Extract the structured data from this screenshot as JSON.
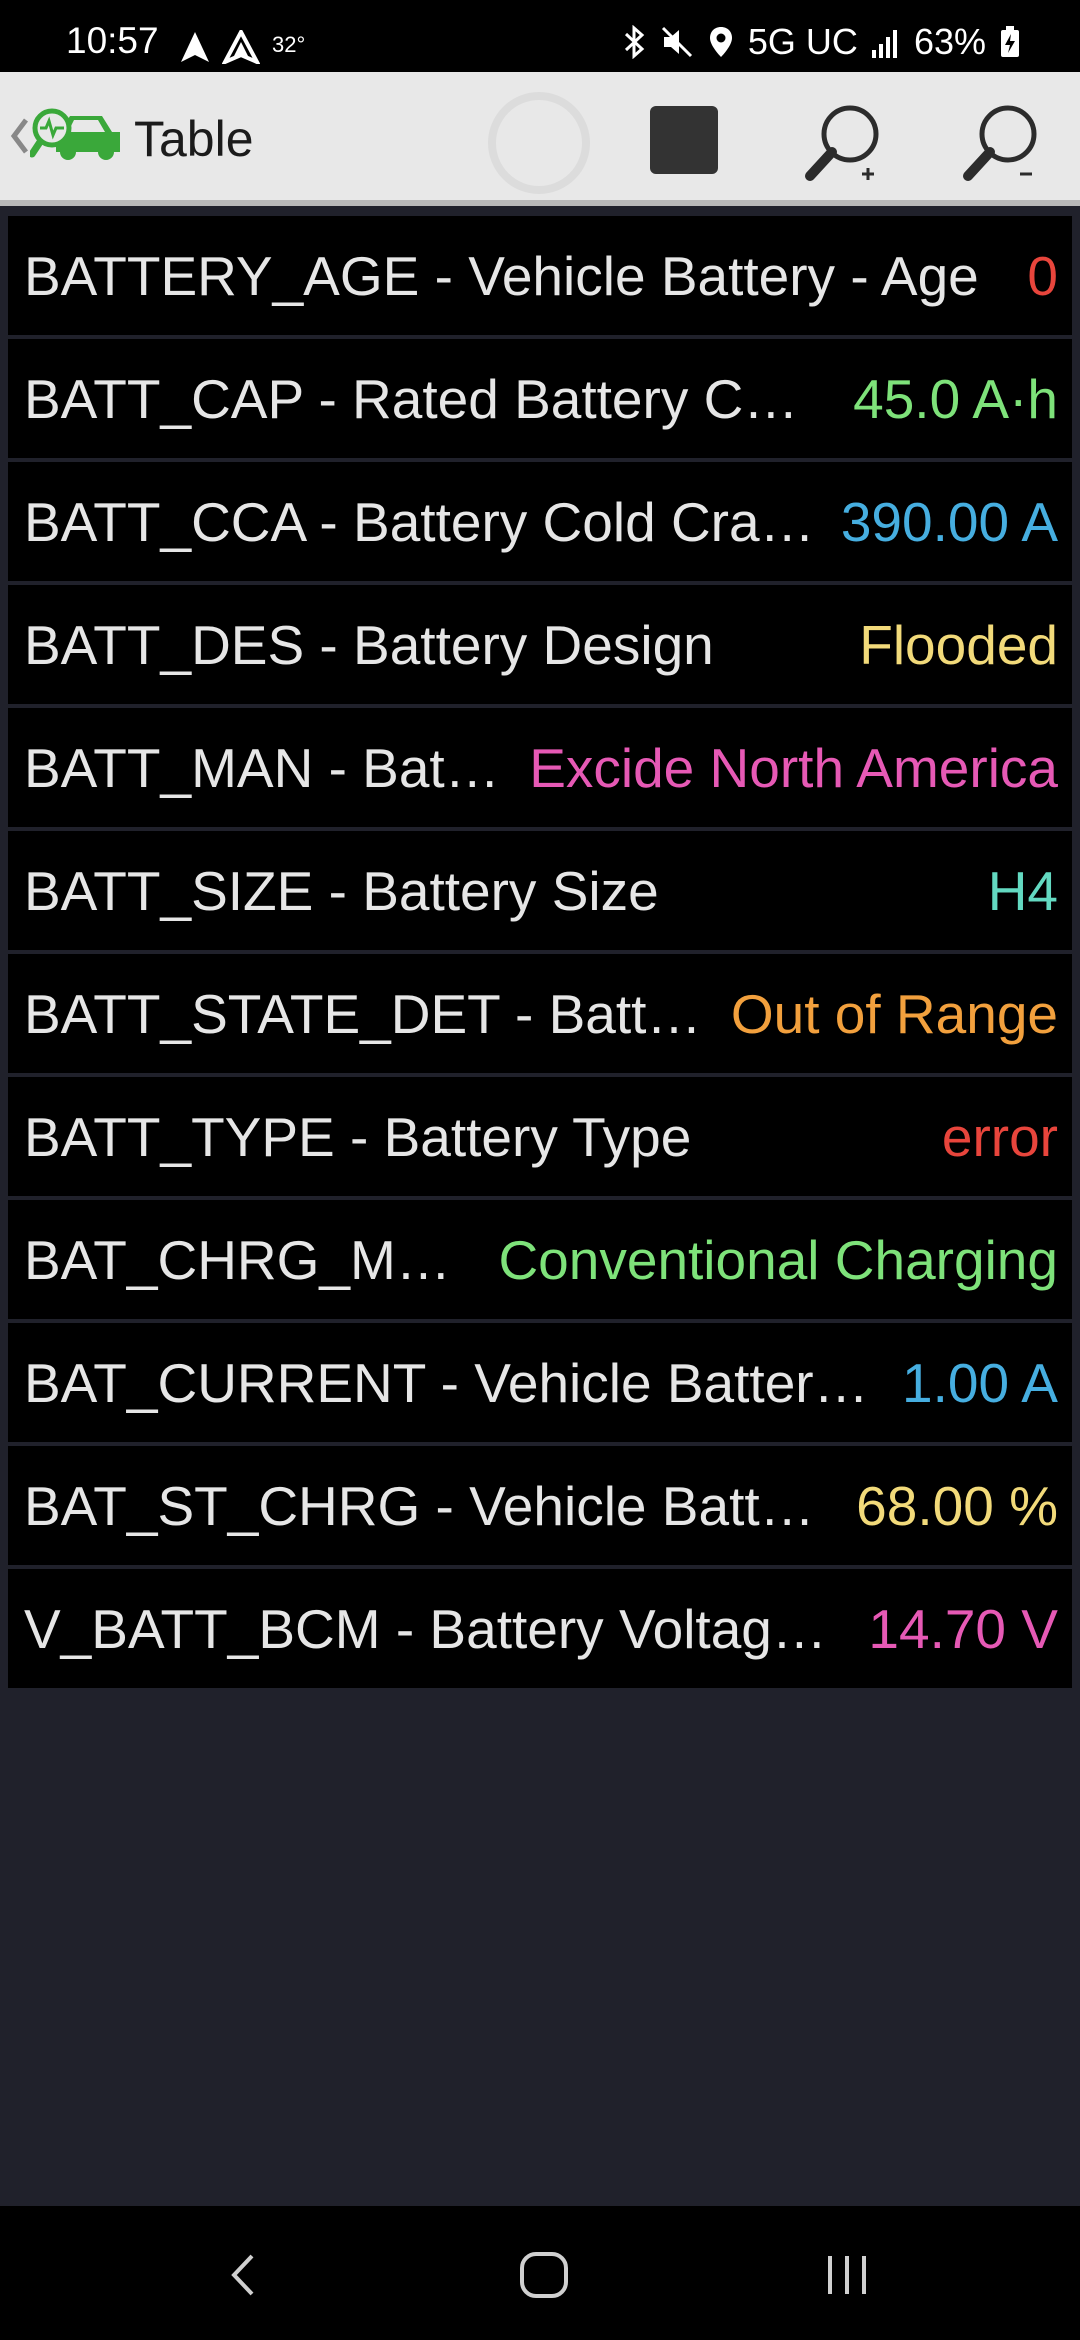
{
  "status_bar": {
    "time": "10:57",
    "temperature": "32°",
    "network": "5G UC",
    "battery": "63%",
    "icons": [
      "navigation-icon",
      "navigation-outline-icon",
      "bluetooth-icon",
      "mute-icon",
      "location-icon",
      "signal-icon",
      "battery-charging-icon"
    ]
  },
  "app_bar": {
    "title": "Table",
    "icons": [
      "back-chevron-icon",
      "car-diagnostic-logo-icon",
      "loading-spinner-icon",
      "stop-icon",
      "zoom-in-icon",
      "zoom-out-icon"
    ]
  },
  "rows": [
    {
      "label": "BATTERY_AGE - Vehicle Battery - Age",
      "value": "0",
      "color": "#e8453c"
    },
    {
      "label": "BATT_CAP - Rated Battery Capacity",
      "value": "45.0 A·h",
      "color": "#7ee27a"
    },
    {
      "label": "BATT_CCA - Battery Cold Cranking Amps",
      "value": "390.00 A",
      "color": "#46aee0"
    },
    {
      "label": "BATT_DES - Battery Design",
      "value": "Flooded",
      "color": "#f2da7a"
    },
    {
      "label": "BATT_MAN - Battery Manufacturer",
      "value": "Excide North America",
      "color": "#e659b5"
    },
    {
      "label": "BATT_SIZE - Battery Size",
      "value": "H4",
      "color": "#63d9c1"
    },
    {
      "label": "BATT_STATE_DET - Battery State Detection",
      "value": "Out of Range",
      "color": "#f2a03d"
    },
    {
      "label": "BATT_TYPE - Battery Type",
      "value": "error",
      "color": "#e8453c"
    },
    {
      "label": "BAT_CHRG_MODE - Battery Charging Mode",
      "value": "Conventional Charging",
      "color": "#7ee27a"
    },
    {
      "label": "BAT_CURRENT - Vehicle Battery Current",
      "value": "1.00 A",
      "color": "#46aee0"
    },
    {
      "label": "BAT_ST_CHRG - Vehicle Battery State of Charge",
      "value": "68.00 %",
      "color": "#f2da7a"
    },
    {
      "label": "V_BATT_BCM - Battery Voltage BCM",
      "value": "14.70 V",
      "color": "#e659b5"
    }
  ],
  "nav_bar": {
    "icons": [
      "back-icon",
      "home-icon",
      "recents-icon"
    ]
  }
}
